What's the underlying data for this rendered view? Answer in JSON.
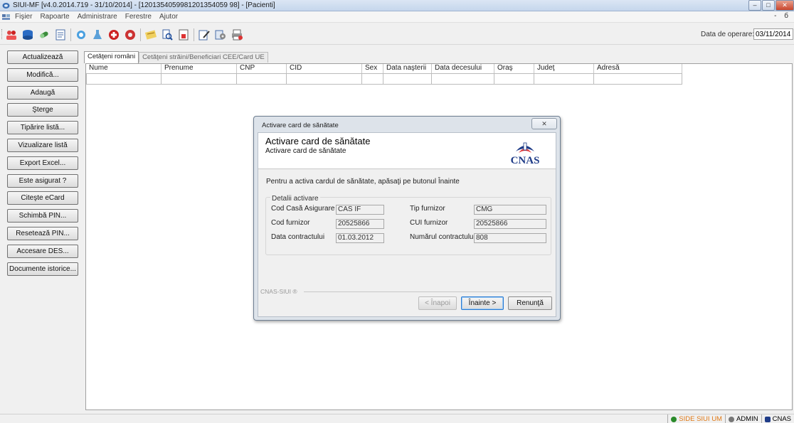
{
  "window": {
    "title": "SIUI-MF [v4.0.2014.719 - 31/10/2014] - [1201354059981201354059 98] - [Pacienti]",
    "controls": [
      "–",
      "□",
      "✕"
    ]
  },
  "menu": {
    "items": [
      "Fişier",
      "Rapoarte",
      "Administrare",
      "Ferestre",
      "Ajutor"
    ],
    "mdi_restore": "- б"
  },
  "toolbar": {
    "operation_date_label": "Data de operare:",
    "operation_date_value": "03/11/2014"
  },
  "left_buttons": [
    "Actualizează",
    "Modifică...",
    "Adaugă",
    "Şterge",
    "Tipărire listă...",
    "Vizualizare listă",
    "Export Excel...",
    "Este asigurat ?",
    "Citeşte eCard",
    "Schimbă PIN...",
    "Resetează PIN...",
    "Accesare DES...",
    "Documente istorice..."
  ],
  "tabs": [
    "Cetăţeni români",
    "Cetăţeni străini/Beneficiari CEE/Card UE"
  ],
  "grid": {
    "columns": [
      "Nume",
      "Prenume",
      "CNP",
      "CID",
      "Sex",
      "Data naşterii",
      "Data decesului",
      "Oraş",
      "Judeţ",
      "Adresă"
    ]
  },
  "dialog": {
    "title": "Activare card de sănătate",
    "close": "✕",
    "header_title": "Activare card de sănătate",
    "header_subtitle": "Activare card de sănătate",
    "logo_text": "CNAS",
    "instruction": "Pentru a activa cardul de sănătate, apăsaţi pe butonul Înainte",
    "details_legend": "Detalii activare",
    "fields": {
      "cod_casa_label": "Cod Casă Asigurare",
      "cod_casa_value": "CAS IF",
      "tip_furnizor_label": "Tip furnizor",
      "tip_furnizor_value": "CMG",
      "cod_furnizor_label": "Cod furnizor",
      "cod_furnizor_value": "20525866",
      "cui_furnizor_label": "CUI furnizor",
      "cui_furnizor_value": "20525866",
      "data_contract_label": "Data contractului",
      "data_contract_value": "01.03.2012",
      "numar_contract_label": "Numărul contractului",
      "numar_contract_value": "808"
    },
    "footer_label": "CNAS-SIUI ®",
    "buttons": {
      "back": "< Înapoi",
      "next": "Înainte >",
      "cancel": "Renunţă"
    }
  },
  "status": {
    "server": "SIDE SIUI UM",
    "user": "ADMIN",
    "org": "CNAS"
  },
  "colors": {
    "accent": "#2a7bd3",
    "status_server": "#e07a18",
    "logo_blue": "#1f3c88"
  }
}
